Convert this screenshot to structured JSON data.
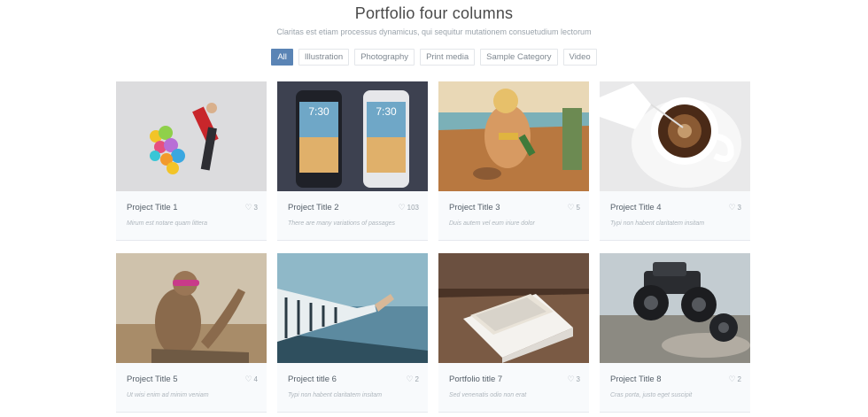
{
  "header": {
    "title": "Portfolio four columns",
    "subtitle": "Claritas est etiam processus dynamicus, qui sequitur mutationem consuetudium lectorum"
  },
  "filters": [
    "All",
    "Illustration",
    "Photography",
    "Print media",
    "Sample Category",
    "Video"
  ],
  "active_filter": "All",
  "accent_color": "#5a84b5",
  "projects": [
    {
      "title": "Project Title 1",
      "likes": "3",
      "desc": "Mirum est notare quam littera"
    },
    {
      "title": "Project Title 2",
      "likes": "103",
      "desc": "There are many variations of passages"
    },
    {
      "title": "Project Title 3",
      "likes": "5",
      "desc": "Duis autem vel eum iriure dolor"
    },
    {
      "title": "Project Title 4",
      "likes": "3",
      "desc": "Typi non habent claritatem insitam"
    },
    {
      "title": "Project Title 5",
      "likes": "4",
      "desc": "Ut wisi enim ad minim veniam"
    },
    {
      "title": "Project title 6",
      "likes": "2",
      "desc": "Typi non habent claritatem insitam"
    },
    {
      "title": "Portfolio title 7",
      "likes": "3",
      "desc": "Sed venenatis odio non erat"
    },
    {
      "title": "Project Title 8",
      "likes": "2",
      "desc": "Cras porta, justo eget suscipit"
    }
  ],
  "icons": {
    "like": "heart-outline-icon"
  }
}
